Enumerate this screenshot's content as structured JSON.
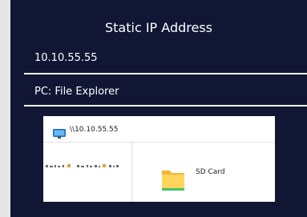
{
  "slide": {
    "title": "Static IP Address",
    "ip_address": "10.10.55.55",
    "pc_line": "PC: File Explorer"
  },
  "explorer": {
    "address_bar": "\\\\10.10.55.55",
    "address_icon": "monitor-icon",
    "nav_pane": "obscured-sidebar-item-icons",
    "item": {
      "icon": "folder-icon",
      "label": "SD Card"
    }
  },
  "colors": {
    "panel_background": "#111634",
    "page_background": "#e6e6e6",
    "folder_yellow": "#ffd55c",
    "folder_green_accent": "#44c466"
  }
}
